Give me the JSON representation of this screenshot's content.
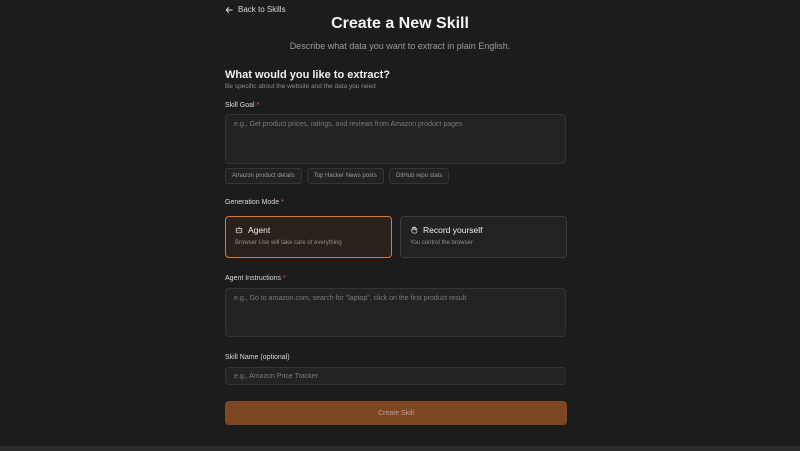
{
  "nav": {
    "back_label": "Back to Skills"
  },
  "header": {
    "title": "Create a New Skill",
    "subtitle": "Describe what data you want to extract in plain English."
  },
  "section": {
    "title": "What would you like to extract?",
    "hint": "Be specific about the website and the data you need"
  },
  "skill_goal": {
    "label": "Skill Goal",
    "required_mark": "*",
    "placeholder": "e.g., Get product prices, ratings, and reviews from Amazon product pages",
    "examples": [
      "Amazon product details",
      "Top Hacker News posts",
      "GitHub repo stats"
    ]
  },
  "generation_mode": {
    "label": "Generation Mode",
    "required_mark": "*",
    "options": [
      {
        "title": "Agent",
        "description": "Browser Use will take care of everything",
        "selected": true,
        "icon": "robot-icon"
      },
      {
        "title": "Record yourself",
        "description": "You control the browser",
        "selected": false,
        "icon": "hand-icon"
      }
    ]
  },
  "agent_instructions": {
    "label": "Agent Instructions",
    "required_mark": "*",
    "placeholder": "e.g., Go to amazon.com, search for \"laptop\", click on the first product result"
  },
  "skill_name": {
    "label": "Skill Name (optional)",
    "placeholder": "e.g., Amazon Price Tracker"
  },
  "submit": {
    "label": "Create Skill"
  },
  "colors": {
    "background": "#1c1c1c",
    "accent": "#d97a3c",
    "button": "#7e4724"
  }
}
